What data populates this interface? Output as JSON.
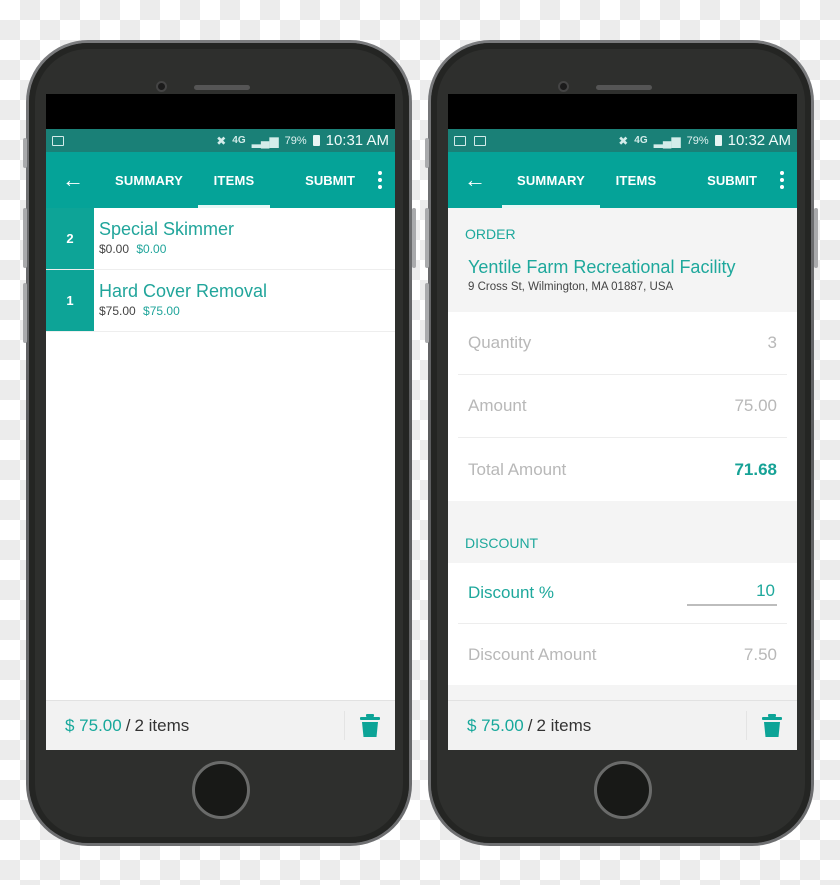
{
  "theme": {
    "primary": "#05a398",
    "status_bar": "#1a8077",
    "accent_text": "#1ea89c",
    "muted_text": "#b8b8b8"
  },
  "phones": [
    {
      "screen": "items",
      "status_bar": {
        "notification_icons": [
          "gmail-icon"
        ],
        "system_icons": [
          "mute-icon",
          "4g-lte-icon",
          "signal-icon"
        ],
        "battery_percent": "79%",
        "time": "10:31 AM"
      },
      "app_bar": {
        "back_icon": "arrow-left-icon",
        "tabs": [
          {
            "label": "SUMMARY",
            "active": false
          },
          {
            "label": "ITEMS",
            "active": true
          }
        ],
        "submit_label": "SUBMIT",
        "more_icon": "more-vertical-icon"
      },
      "items": [
        {
          "qty": "2",
          "name": "Special Skimmer",
          "price": "$0.00",
          "total": "$0.00"
        },
        {
          "qty": "1",
          "name": "Hard Cover Removal",
          "price": "$75.00",
          "total": "$75.00"
        }
      ],
      "footer": {
        "amount": "$ 75.00",
        "separator": "/",
        "count": "2 items",
        "trash_icon": "trash-icon"
      }
    },
    {
      "screen": "summary",
      "status_bar": {
        "notification_icons": [
          "gallery-icon",
          "gmail-icon"
        ],
        "system_icons": [
          "mute-icon",
          "4g-lte-icon",
          "signal-icon"
        ],
        "battery_percent": "79%",
        "time": "10:32 AM"
      },
      "app_bar": {
        "back_icon": "arrow-left-icon",
        "tabs": [
          {
            "label": "SUMMARY",
            "active": true
          },
          {
            "label": "ITEMS",
            "active": false
          }
        ],
        "submit_label": "SUBMIT",
        "more_icon": "more-vertical-icon"
      },
      "order": {
        "section_label": "ORDER",
        "customer_name": "Yentile Farm Recreational Facility",
        "address": "9 Cross St, Wilmington, MA 01887, USA"
      },
      "totals": [
        {
          "label": "Quantity",
          "value": "3"
        },
        {
          "label": "Amount",
          "value": "75.00"
        },
        {
          "label": "Total Amount",
          "value": "71.68"
        }
      ],
      "discount": {
        "section_label": "DISCOUNT",
        "percent_label": "Discount %",
        "percent_value": "10",
        "amount_label": "Discount Amount",
        "amount_value": "7.50"
      },
      "footer": {
        "amount": "$ 75.00",
        "separator": "/",
        "count": "2 items",
        "trash_icon": "trash-icon"
      }
    }
  ]
}
